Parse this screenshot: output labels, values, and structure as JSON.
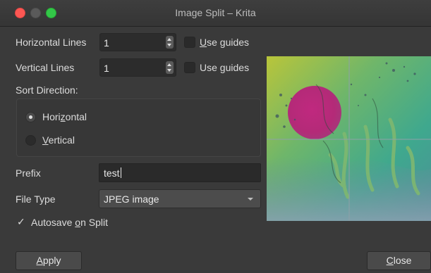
{
  "window": {
    "title": "Image Split – Krita"
  },
  "horizontal": {
    "label": "Horizontal Lines",
    "value": "1",
    "guides_label_first": "U",
    "guides_label_rest": "se guides"
  },
  "vertical": {
    "label": "Vertical Lines",
    "value": "1",
    "guides_label_first": "Use ",
    "guides_label_underline": "g",
    "guides_label_rest": "uides"
  },
  "sort": {
    "label": "Sort Direction:",
    "options": [
      {
        "pre": "Hori",
        "ul": "z",
        "post": "ontal",
        "checked": true
      },
      {
        "pre": "",
        "ul": "V",
        "post": "ertical",
        "checked": false
      }
    ]
  },
  "prefix": {
    "label": "Prefix",
    "value": "test"
  },
  "file_type": {
    "label": "File Type",
    "value": "JPEG image"
  },
  "autosave": {
    "mark": "✓",
    "pre": "Autosave ",
    "ul": "o",
    "post": "n Split"
  },
  "buttons": {
    "apply_ul": "A",
    "apply_rest": "pply",
    "close_ul": "C",
    "close_rest": "lose"
  },
  "preview": {
    "description": "split preview"
  }
}
